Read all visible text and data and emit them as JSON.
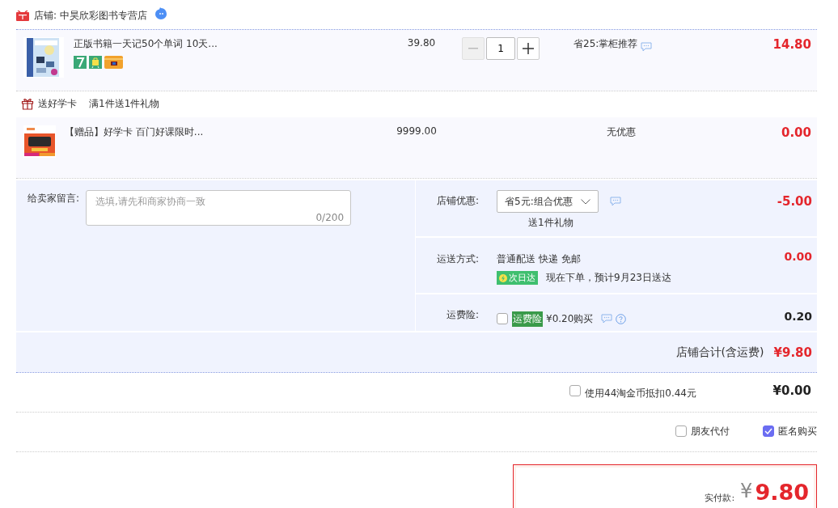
{
  "store": {
    "label": "店铺: 中昊欣彩图书专营店"
  },
  "product": {
    "title": "正版书籍一天记50个单词 10天...",
    "price": "39.80",
    "quantity": "1",
    "discount": "省25:掌柜推荐",
    "total": "14.80"
  },
  "gift_header": {
    "label": "送好学卡",
    "rule": "满1件送1件礼物"
  },
  "gift": {
    "title": "【赠品】好学卡 百门好课限时...",
    "price": "9999.00",
    "discount": "无优惠",
    "total": "0.00"
  },
  "message": {
    "label": "给卖家留言:",
    "placeholder": "选填,请先和商家协商一致",
    "counter": "0/200"
  },
  "store_discount": {
    "label": "店铺优惠:",
    "value": "省5元:组合优惠",
    "note": "送1件礼物",
    "amount": "-5.00",
    "highlight": true
  },
  "shipping": {
    "label": "运送方式:",
    "method": "普通配送 快递 免邮",
    "badge": "次日达",
    "eta": "现在下单，预计9月23日送达",
    "amount": "0.00",
    "highlight": true
  },
  "insurance": {
    "label": "运费险:",
    "checked": false,
    "tag": "运费险",
    "price": "¥0.20购买",
    "amount": "0.20",
    "highlight": false
  },
  "store_total": {
    "label": "店铺合计(含运费)",
    "amount": "¥9.80"
  },
  "coins": {
    "label": "使用44淘金币抵扣0.44元",
    "checked": false,
    "amount": "¥0.00"
  },
  "options": [
    {
      "label": "朋友代付",
      "checked": false
    },
    {
      "label": "匿名购买",
      "checked": true
    }
  ],
  "payment": {
    "label": "实付款:",
    "currency": "¥",
    "amount": "9.80"
  }
}
